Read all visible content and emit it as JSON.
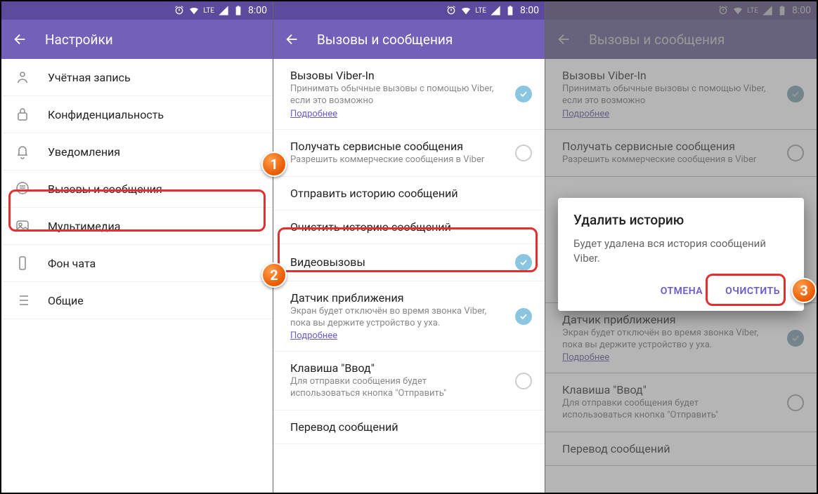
{
  "status": {
    "time": "8:00",
    "lte": "LTE"
  },
  "screen1": {
    "title": "Настройки",
    "items": [
      {
        "label": "Учётная запись"
      },
      {
        "label": "Конфиденциальность"
      },
      {
        "label": "Уведомления"
      },
      {
        "label": "Вызовы и сообщения"
      },
      {
        "label": "Мультимедиа"
      },
      {
        "label": "Фон чата"
      },
      {
        "label": "Общие"
      }
    ]
  },
  "screen2": {
    "title": "Вызовы и сообщения",
    "items": {
      "viberin": {
        "title": "Вызовы Viber-In",
        "sub": "Принимать обычные вызовы с помощью Viber, если это возможно",
        "link": "Подробнее"
      },
      "service": {
        "title": "Получать сервисные сообщения",
        "sub": "Разрешить коммерческие сообщения в Viber"
      },
      "send_history": {
        "title": "Отправить историю сообщений"
      },
      "clear_history": {
        "title": "Очистить историю сообщений"
      },
      "video": {
        "title": "Видеовызовы"
      },
      "proximity": {
        "title": "Датчик приближения",
        "sub": "Экран будет отключён во время звонка Viber, пока вы держите устройство у уха.",
        "link": "Подробнее"
      },
      "enter_key": {
        "title": "Клавиша \"Ввод\"",
        "sub": "Для отправки сообщения будет использоваться кнопка \"Отправить\""
      },
      "translate": {
        "title": "Перевод сообщений"
      }
    }
  },
  "dialog": {
    "title": "Удалить историю",
    "body": "Будет удалена вся история сообщений Viber.",
    "cancel": "ОТМЕНА",
    "confirm": "ОЧИСТИТЬ"
  },
  "badges": {
    "b1": "1",
    "b2": "2",
    "b3": "3"
  }
}
